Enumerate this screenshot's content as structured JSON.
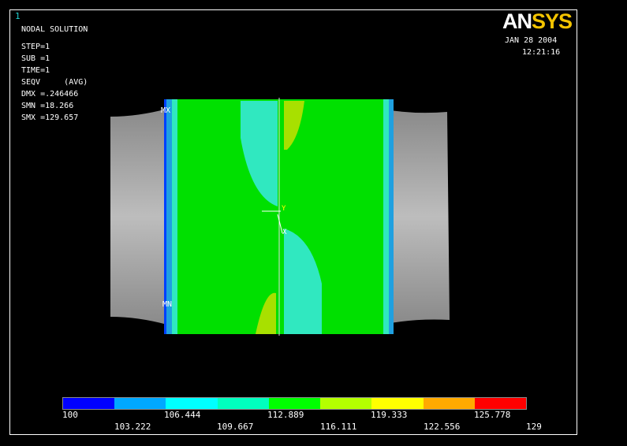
{
  "window_number": "1",
  "header": {
    "title": "NODAL SOLUTION",
    "info_lines": [
      "STEP=1",
      "SUB =1",
      "TIME=1",
      "SEQV     (AVG)",
      "DMX =.246466",
      "SMN =18.266",
      "SMX =129.657"
    ]
  },
  "logo": {
    "part1": "AN",
    "part2": "SYS"
  },
  "date": "JAN 28 2004",
  "time": "12:21:16",
  "markers": {
    "max": "MX",
    "min": "MN",
    "axis_y": "Y",
    "axis_x": "X"
  },
  "legend": {
    "colors": [
      "#0000ff",
      "#00a8ff",
      "#00ffff",
      "#00ffbe",
      "#00ff00",
      "#b4ff00",
      "#ffff00",
      "#ffaa00",
      "#ff0000"
    ],
    "labels_top": [
      "100",
      "106.444",
      "112.889",
      "119.333",
      "125.778"
    ],
    "labels_bottom": [
      "103.222",
      "109.667",
      "116.111",
      "122.556",
      "129"
    ]
  }
}
